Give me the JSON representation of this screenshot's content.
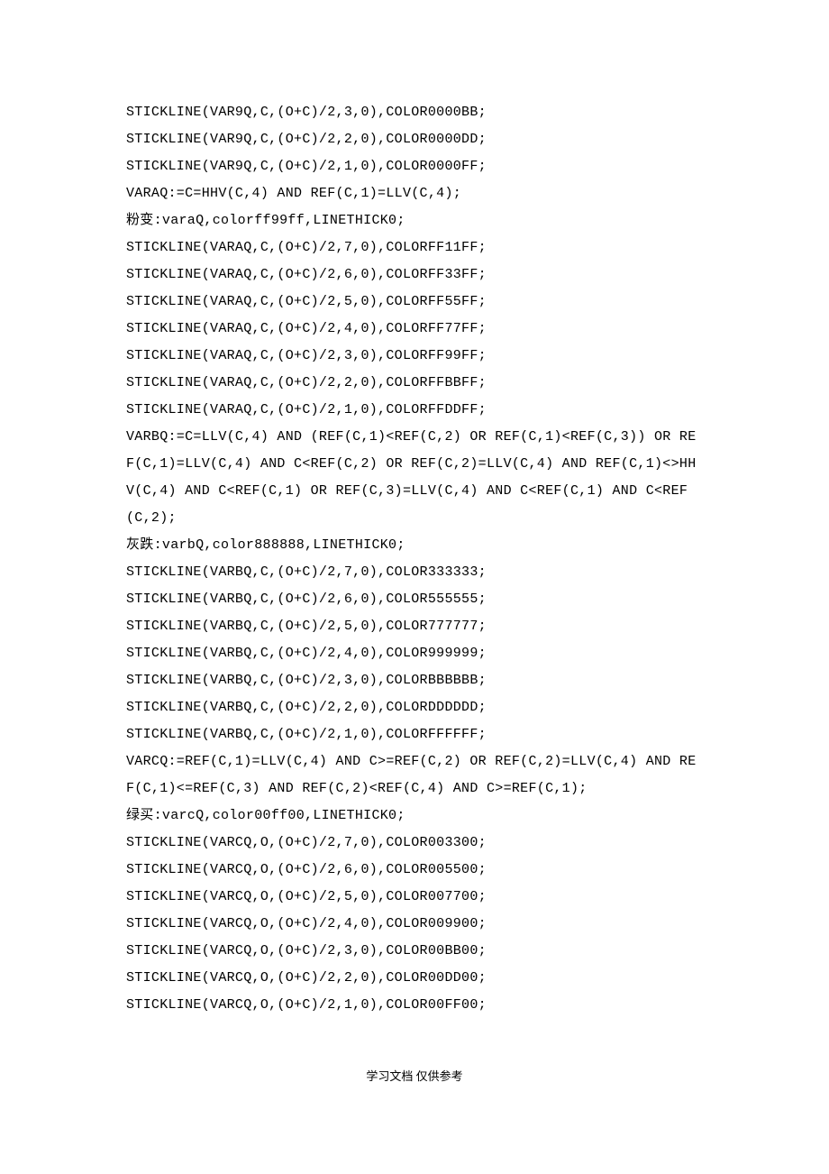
{
  "lines": [
    "STICKLINE(VAR9Q,C,(O+C)/2,3,0),COLOR0000BB;",
    "STICKLINE(VAR9Q,C,(O+C)/2,2,0),COLOR0000DD;",
    "STICKLINE(VAR9Q,C,(O+C)/2,1,0),COLOR0000FF;",
    "VARAQ:=C=HHV(C,4) AND REF(C,1)=LLV(C,4);",
    "粉变:varaQ,colorff99ff,LINETHICK0;",
    "STICKLINE(VARAQ,C,(O+C)/2,7,0),COLORFF11FF;",
    "STICKLINE(VARAQ,C,(O+C)/2,6,0),COLORFF33FF;",
    "STICKLINE(VARAQ,C,(O+C)/2,5,0),COLORFF55FF;",
    "STICKLINE(VARAQ,C,(O+C)/2,4,0),COLORFF77FF;",
    "STICKLINE(VARAQ,C,(O+C)/2,3,0),COLORFF99FF;",
    "STICKLINE(VARAQ,C,(O+C)/2,2,0),COLORFFBBFF;",
    "STICKLINE(VARAQ,C,(O+C)/2,1,0),COLORFFDDFF;",
    "VARBQ:=C=LLV(C,4) AND (REF(C,1)<REF(C,2) OR REF(C,1)<REF(C,3)) OR REF(C,1)=LLV(C,4) AND C<REF(C,2) OR REF(C,2)=LLV(C,4) AND REF(C,1)<>HHV(C,4) AND C<REF(C,1) OR REF(C,3)=LLV(C,4) AND C<REF(C,1) AND C<REF(C,2);",
    "灰跌:varbQ,color888888,LINETHICK0;",
    "STICKLINE(VARBQ,C,(O+C)/2,7,0),COLOR333333;",
    "STICKLINE(VARBQ,C,(O+C)/2,6,0),COLOR555555;",
    "STICKLINE(VARBQ,C,(O+C)/2,5,0),COLOR777777;",
    "STICKLINE(VARBQ,C,(O+C)/2,4,0),COLOR999999;",
    "STICKLINE(VARBQ,C,(O+C)/2,3,0),COLORBBBBBB;",
    "STICKLINE(VARBQ,C,(O+C)/2,2,0),COLORDDDDDD;",
    "STICKLINE(VARBQ,C,(O+C)/2,1,0),COLORFFFFFF;",
    "VARCQ:=REF(C,1)=LLV(C,4) AND C>=REF(C,2) OR REF(C,2)=LLV(C,4) AND REF(C,1)<=REF(C,3) AND REF(C,2)<REF(C,4) AND C>=REF(C,1);",
    "绿买:varcQ,color00ff00,LINETHICK0;",
    "STICKLINE(VARCQ,O,(O+C)/2,7,0),COLOR003300;",
    "STICKLINE(VARCQ,O,(O+C)/2,6,0),COLOR005500;",
    "STICKLINE(VARCQ,O,(O+C)/2,5,0),COLOR007700;",
    "STICKLINE(VARCQ,O,(O+C)/2,4,0),COLOR009900;",
    "STICKLINE(VARCQ,O,(O+C)/2,3,0),COLOR00BB00;",
    "STICKLINE(VARCQ,O,(O+C)/2,2,0),COLOR00DD00;",
    "STICKLINE(VARCQ,O,(O+C)/2,1,0),COLOR00FF00;"
  ],
  "footer": "学习文档 仅供参考"
}
